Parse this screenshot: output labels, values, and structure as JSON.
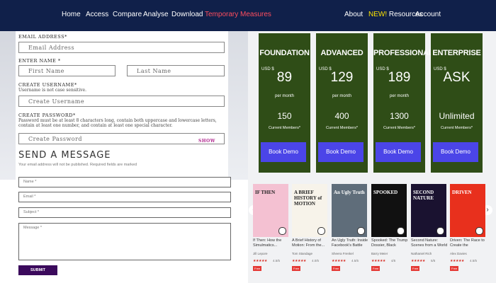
{
  "nav": {
    "left": [
      "Home",
      "Access",
      "Compare",
      "Analyse",
      "Download",
      "Temporary Measures"
    ],
    "about": "About",
    "new": "NEW!",
    "resources": "Resources",
    "account": "Account"
  },
  "form": {
    "email_label": "EMAIL ADDRESS*",
    "email_placeholder": "Email Address",
    "name_label": "ENTER NAME *",
    "first_placeholder": "First Name",
    "last_placeholder": "Last Name",
    "username_label": "CREATE USERNAME*",
    "username_hint": "Username is not case sensitive.",
    "username_placeholder": "Create Username",
    "password_label": "CREATE PASSWORD*",
    "password_hint": "Password must be at least 8 characters long, contain both uppercase and lowercase letters, contain at least one number, and contain at least one special character.",
    "password_placeholder": "Create Password",
    "show_label": "SHOW"
  },
  "message": {
    "title": "SEND A MESSAGE",
    "note": "Your email address will not be published. Required fields are marked",
    "name_placeholder": "Name *",
    "email_placeholder": "Email *",
    "subject_placeholder": "Subject *",
    "message_placeholder": "Message *",
    "submit": "SUBMIT"
  },
  "plans": [
    {
      "name": "FOUNDATION",
      "currency": "USD $",
      "price": "89",
      "per": "per month",
      "members": "150",
      "members_label": "Current Members*",
      "cta": "Book Demo"
    },
    {
      "name": "ADVANCED",
      "currency": "USD $",
      "price": "129",
      "per": "per month",
      "members": "400",
      "members_label": "Current Members*",
      "cta": "Book Demo"
    },
    {
      "name": "PROFESSIONAL",
      "currency": "USD $",
      "price": "189",
      "per": "per month",
      "members": "1300",
      "members_label": "Current Members*",
      "cta": "Book Demo"
    },
    {
      "name": "ENTERPRISE",
      "currency": "USD $",
      "price": "ASK",
      "per": "",
      "members": "Unlimited",
      "members_label": "Current Members*",
      "cta": "Book Demo"
    }
  ],
  "books": [
    {
      "title": "If Then: How the Simulmatics...",
      "author": "Jill Lepore",
      "rating": "4.5/5",
      "badge": "Free",
      "cover": "#f4c1d2",
      "cover_text": "IF THEN"
    },
    {
      "title": "A Brief History of Motion: From the...",
      "author": "Tom Standage",
      "rating": "4.0/5",
      "badge": "Free",
      "cover": "#f7f3ea",
      "cover_text": "A BRIEF HISTORY of MOTION"
    },
    {
      "title": "An Ugly Truth: Inside Facebook's Battle for...",
      "author": "Sheera Frenkel",
      "rating": "4.5/5",
      "badge": "Free",
      "cover": "#5f6d7a",
      "cover_text": "An Ugly Truth"
    },
    {
      "title": "Spooked: The Trump Dossier, Black Cube,...",
      "author": "Barry Meier",
      "rating": "4/5",
      "badge": "Free",
      "cover": "#111111",
      "cover_text": "SPOOKED"
    },
    {
      "title": "Second Nature: Scenes from a World Remade",
      "author": "Nathaniel Rich",
      "rating": "5/5",
      "badge": "Free",
      "cover": "#1a1230",
      "cover_text": "SECOND NATURE"
    },
    {
      "title": "Driven: The Race to Create the Autonomo...",
      "author": "Alex Davies",
      "rating": "4.5/5",
      "badge": "Free",
      "cover": "#e8301d",
      "cover_text": "DRIVEN"
    }
  ],
  "colors": {
    "nav_bg": "#10204a",
    "card_bg": "#2f4d17",
    "cta_bg": "#4b45e8",
    "highlight": "#ff4d5e",
    "new": "#ffe500"
  },
  "icons": {
    "prev": "chevron-left-icon",
    "next": "chevron-right-icon"
  }
}
